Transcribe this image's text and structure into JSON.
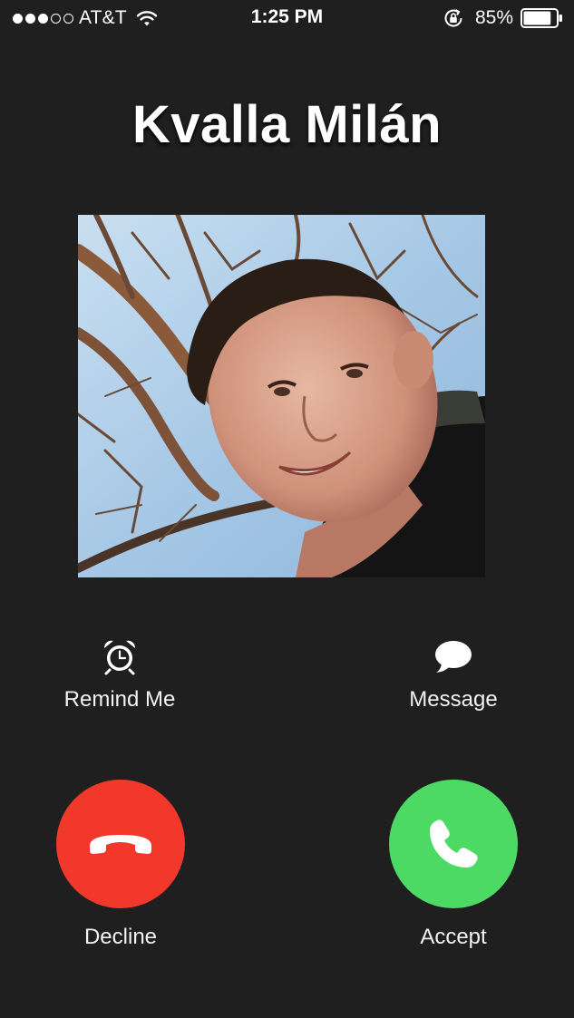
{
  "status_bar": {
    "signal_dots_filled": 3,
    "signal_dots_total": 5,
    "carrier": "AT&T",
    "time": "1:25 PM",
    "battery_percent": "85%",
    "battery_level": 0.85,
    "icons": [
      "wifi-icon",
      "orientation-lock-icon",
      "battery-icon"
    ]
  },
  "caller": {
    "name": "Kvalla Milán"
  },
  "actions": {
    "remind_label": "Remind Me",
    "remind_icon": "alarm-clock-icon",
    "message_label": "Message",
    "message_icon": "speech-bubble-icon"
  },
  "call_buttons": {
    "decline_label": "Decline",
    "decline_color": "#f2382b",
    "decline_icon": "phone-hangup-icon",
    "accept_label": "Accept",
    "accept_color": "#4cd964",
    "accept_icon": "phone-icon"
  },
  "colors": {
    "background": "#1f1f1f",
    "text": "#ffffff"
  }
}
